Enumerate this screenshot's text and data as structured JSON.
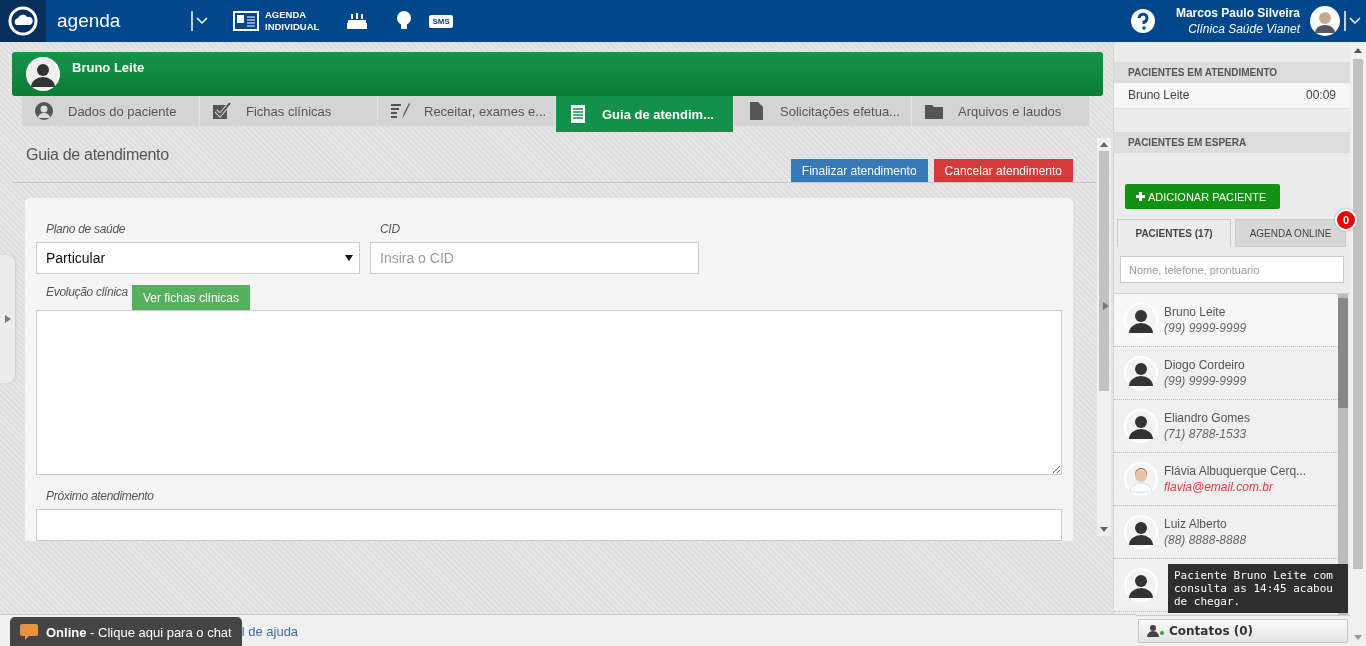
{
  "topbar": {
    "app_name": "agenda",
    "agenda_button": [
      "AGENDA",
      "INDIVIDUAL"
    ],
    "sms_label": "SMS",
    "user": {
      "name": "Marcos Paulo Silveira",
      "clinic": "Clínica Saúde Vianet"
    }
  },
  "patient_header": {
    "name": "Bruno Leite"
  },
  "tabs": [
    {
      "label": "Dados do paciente",
      "kind": "person",
      "selected": false
    },
    {
      "label": "Fichas clínicas",
      "kind": "check",
      "selected": false
    },
    {
      "label": "Receitar, exames e...",
      "kind": "pen",
      "selected": false
    },
    {
      "label": "Guia de atendim...",
      "kind": "list",
      "selected": true
    },
    {
      "label": "Solicitações efetua...",
      "kind": "file",
      "selected": false
    },
    {
      "label": "Arquivos e laudos",
      "kind": "folder",
      "selected": false
    }
  ],
  "page_title": "Guia de atendimento",
  "actions": [
    {
      "label": "Finalizar atendimento",
      "kind": "primary"
    },
    {
      "label": "Cancelar atendimento",
      "kind": "danger"
    }
  ],
  "form": {
    "health_plan": {
      "label": "Plano de saúde",
      "value": "Particular"
    },
    "cid": {
      "label": "CID",
      "placeholder": "Insira o CID"
    },
    "evolution": {
      "label": "Evolução clínica",
      "button": "Ver fichas clínicas"
    },
    "next_visit": {
      "label": "Próximo atendimento"
    }
  },
  "sidebar": {
    "in_service": {
      "title": "PACIENTES EM ATENDIMENTO",
      "rows": [
        {
          "name": "Bruno Leite",
          "time": "00:09"
        }
      ]
    },
    "waiting": {
      "title": "PACIENTES EM ESPERA",
      "add_button": "ADICIONAR PACIENTE",
      "tabs": [
        {
          "label": "PACIENTES (17)",
          "selected": true
        },
        {
          "label": "AGENDA ONLINE",
          "selected": false,
          "badge": "0"
        }
      ],
      "search": {
        "placeholder": "Nome, telefone, prontuario"
      },
      "patients": [
        {
          "name": "Bruno Leite",
          "contact": "(99) 9999-9999",
          "kind": "phone",
          "photo": false
        },
        {
          "name": "Diogo Cordeiro",
          "contact": "(99) 9999-9999",
          "kind": "phone",
          "photo": false
        },
        {
          "name": "Eliandro Gomes",
          "contact": "(71) 8788-1533",
          "kind": "phone",
          "photo": false
        },
        {
          "name": "Flávia Albuquerque Cerq...",
          "contact": "flavia@email.com.br",
          "kind": "email",
          "photo": true
        },
        {
          "name": "Luiz Alberto",
          "contact": "(88) 8888-8888",
          "kind": "phone",
          "photo": false
        },
        {
          "photo": false
        }
      ]
    },
    "tooltip": "Paciente Bruno Leite com consulta as 14:45 acabou de chegar.",
    "contacts_button": "Contatos (0)"
  },
  "footer": {
    "chat": "**Online** - Clique aqui para o chat",
    "help_link": "l de ajuda"
  }
}
